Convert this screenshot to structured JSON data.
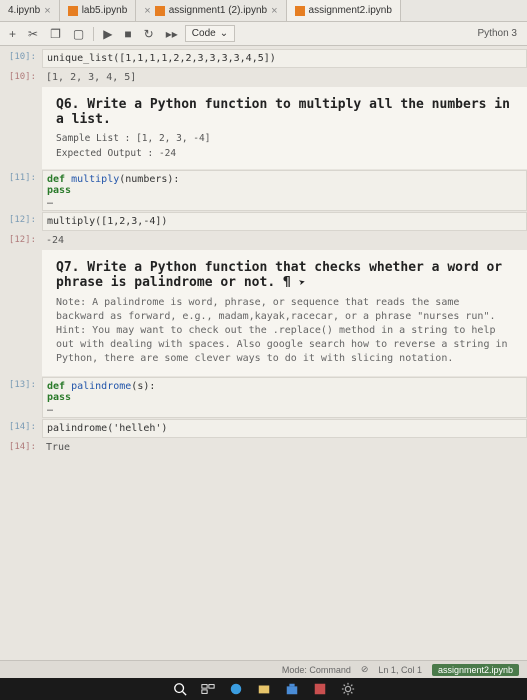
{
  "tabs": [
    {
      "label": "4.ipynb"
    },
    {
      "label": "lab5.ipynb"
    },
    {
      "label": "assignment1 (2).ipynb"
    },
    {
      "label": "assignment2.ipynb"
    }
  ],
  "toolbar": {
    "code_label": "Code",
    "kernel": "Python 3"
  },
  "cells": {
    "c10_prompt": "[10]:",
    "c10_code": "unique_list([1,1,1,1,2,2,3,3,3,3,4,5])",
    "c10_out_prompt": "[10]:",
    "c10_out": "[1, 2, 3, 4, 5]",
    "q6_title": "Q6. Write a Python function to multiply all the numbers in a list.",
    "q6_sample1": "Sample List : [1, 2, 3, -4]",
    "q6_sample2": "Expected Output : -24",
    "c11_prompt": "[11]:",
    "c11_code_l1_kw": "def",
    "c11_code_l1_fn": " multiply",
    "c11_code_l1_rest": "(numbers):",
    "c11_code_l2": "    pass",
    "c11_dots": "…",
    "c12_prompt": "[12]:",
    "c12_code": "multiply([1,2,3,-4])",
    "c12_out_prompt": "[12]:",
    "c12_out": "-24",
    "q7_title": "Q7. Write a Python function that checks whether a word or phrase is palindrome or not. ¶",
    "q7_note": "Note: A palindrome is word, phrase, or sequence that reads the same backward as forward, e.g., madam,kayak,racecar, or a phrase \"nurses run\". Hint: You may want to check out the .replace() method in a string to help out with dealing with spaces. Also google search how to reverse a string in Python, there are some clever ways to do it with slicing notation.",
    "c13_prompt": "[13]:",
    "c13_code_l1_kw": "def",
    "c13_code_l1_fn": " palindrome",
    "c13_code_l1_rest": "(s):",
    "c13_code_l2": "    pass",
    "c13_dots": "…",
    "c14_prompt": "[14]:",
    "c14_code": "palindrome('helleh')",
    "c14_out_prompt": "[14]:",
    "c14_out": "True"
  },
  "status": {
    "mode": "Mode: Command",
    "saved_icon": "⊘",
    "pos": "Ln 1, Col 1",
    "file": "assignment2.ipynb"
  },
  "taskbar_icons": [
    "search",
    "task-view",
    "edge",
    "files",
    "store",
    "app",
    "settings"
  ]
}
